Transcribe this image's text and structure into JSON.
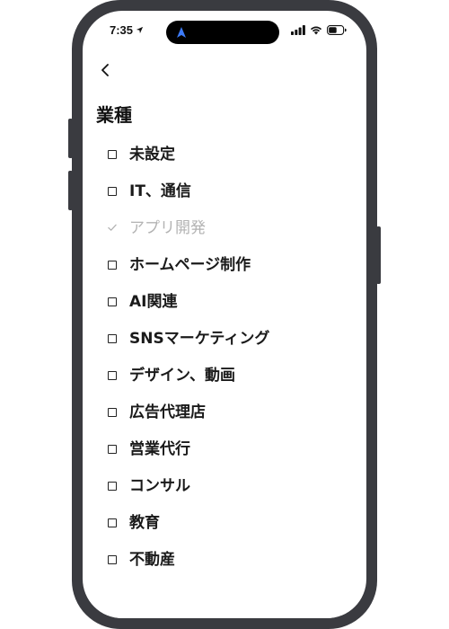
{
  "status_bar": {
    "time": "7:35"
  },
  "page": {
    "section_title": "業種"
  },
  "colors": {
    "frame": "#3a3b40",
    "selected_text": "#b3b3b3",
    "text": "#1a1a1a"
  },
  "industries": [
    {
      "label": "未設定",
      "selected": false
    },
    {
      "label": "IT、通信",
      "selected": false
    },
    {
      "label": "アプリ開発",
      "selected": true
    },
    {
      "label": "ホームページ制作",
      "selected": false
    },
    {
      "label": "AI関連",
      "selected": false
    },
    {
      "label": "SNSマーケティング",
      "selected": false
    },
    {
      "label": "デザイン、動画",
      "selected": false
    },
    {
      "label": "広告代理店",
      "selected": false
    },
    {
      "label": "営業代行",
      "selected": false
    },
    {
      "label": "コンサル",
      "selected": false
    },
    {
      "label": "教育",
      "selected": false
    },
    {
      "label": "不動産",
      "selected": false
    }
  ]
}
